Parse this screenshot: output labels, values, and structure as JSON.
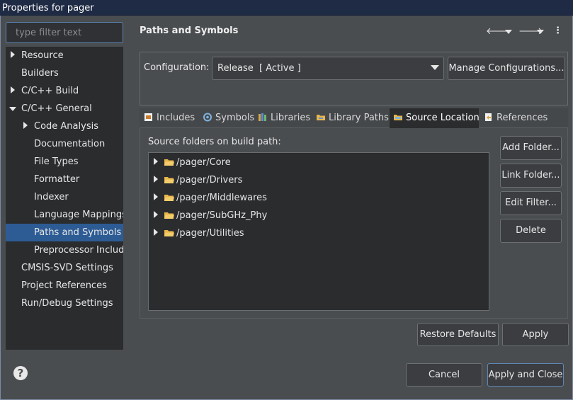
{
  "window": {
    "title": "Properties for pager"
  },
  "filter": {
    "placeholder": "type filter text"
  },
  "tree": {
    "items": [
      {
        "label": "Resource",
        "expander": "collapsed"
      },
      {
        "label": "Builders",
        "expander": "none"
      },
      {
        "label": "C/C++ Build",
        "expander": "collapsed"
      },
      {
        "label": "C/C++ General",
        "expander": "expanded"
      },
      {
        "label": "Code Analysis",
        "expander": "collapsed"
      },
      {
        "label": "Documentation",
        "expander": "none"
      },
      {
        "label": "File Types",
        "expander": "none"
      },
      {
        "label": "Formatter",
        "expander": "none"
      },
      {
        "label": "Indexer",
        "expander": "none"
      },
      {
        "label": "Language Mappings",
        "expander": "none"
      },
      {
        "label": "Paths and Symbols",
        "expander": "none",
        "selected": true
      },
      {
        "label": "Preprocessor Include",
        "expander": "none"
      },
      {
        "label": "CMSIS-SVD Settings",
        "expander": "none"
      },
      {
        "label": "Project References",
        "expander": "none"
      },
      {
        "label": "Run/Debug Settings",
        "expander": "none"
      }
    ]
  },
  "help": {
    "icon": "help-icon",
    "glyph": "?"
  },
  "page": {
    "title": "Paths and Symbols",
    "nav": {
      "back_glyph": "🡐",
      "forward_glyph": "🡒",
      "menu_glyph": "⋮"
    }
  },
  "config": {
    "label": "Configuration:",
    "selected": "Release  [ Active ]",
    "manage_label": "Manage Configurations..."
  },
  "tabs": [
    {
      "label": "Includes",
      "icon": "includes-icon",
      "active": false
    },
    {
      "label": "Symbols",
      "icon": "symbols-icon",
      "active": false
    },
    {
      "label": "Libraries",
      "icon": "libraries-icon",
      "active": false
    },
    {
      "label": "Library Paths",
      "icon": "library-paths-icon",
      "active": false
    },
    {
      "label": "Source Location",
      "icon": "source-location-icon",
      "active": true
    },
    {
      "label": "References",
      "icon": "references-icon",
      "active": false
    }
  ],
  "source": {
    "label": "Source folders on build path:",
    "folders": [
      "/pager/Core",
      "/pager/Drivers",
      "/pager/Middlewares",
      "/pager/SubGHz_Phy",
      "/pager/Utilities"
    ],
    "buttons": {
      "add_folder": "Add Folder...",
      "link_folder": "Link Folder...",
      "edit_filter": "Edit Filter...",
      "delete": "Delete"
    }
  },
  "footer": {
    "restore_defaults": "Restore Defaults",
    "apply": "Apply",
    "cancel": "Cancel",
    "apply_and_close": "Apply and Close"
  },
  "colors": {
    "selection": "#2d5c95",
    "folder": "#e8b64a",
    "titlebar": "#1f2a44"
  }
}
